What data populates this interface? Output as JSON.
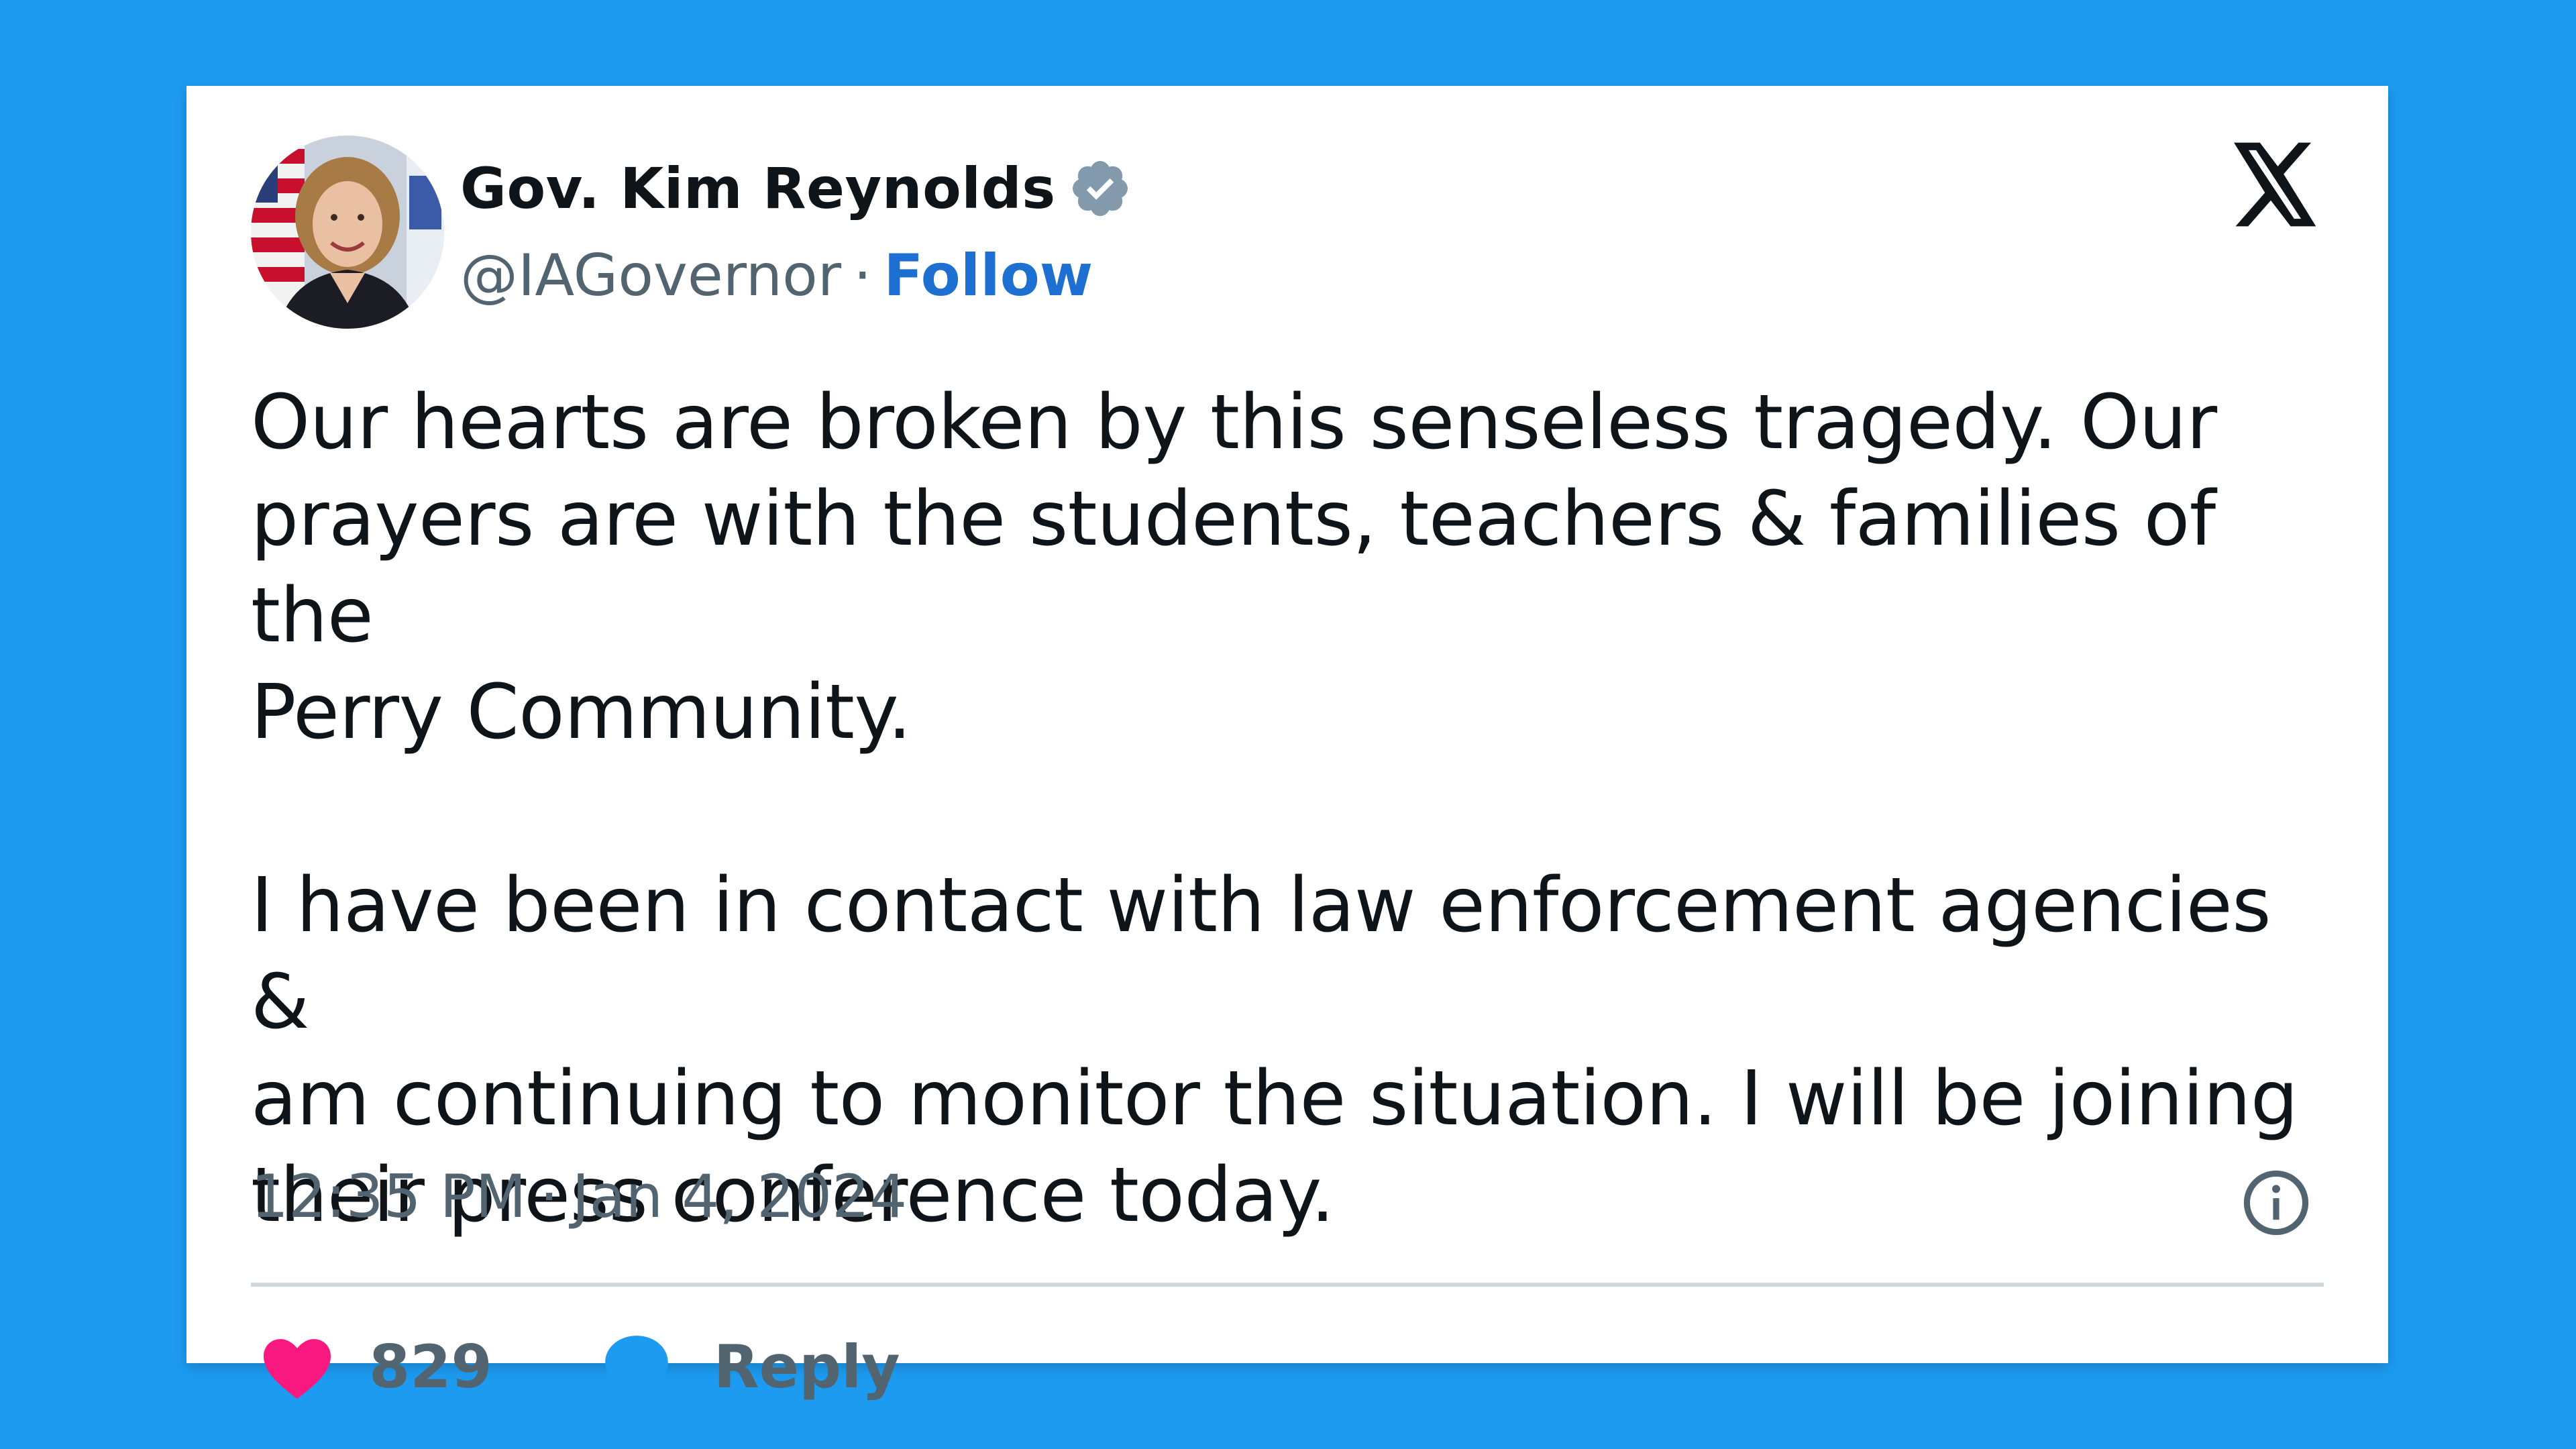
{
  "author": {
    "display_name": "Gov. Kim Reynolds",
    "handle": "@IAGovernor",
    "separator": "·",
    "follow_label": "Follow",
    "verified_icon": "verified-badge-icon",
    "avatar_icon": "avatar"
  },
  "tweet": {
    "paragraph_1": "Our hearts are broken by this senseless tragedy. Our\nprayers are with the students, teachers & families of the\nPerry Community.",
    "paragraph_2": "I have been in contact with law enforcement agencies &\nam continuing to monitor the situation. I will be joining\ntheir press conference today."
  },
  "meta": {
    "time": "12:35 PM",
    "separator": "·",
    "date": "Jan 4, 2024"
  },
  "actions": {
    "like_count": "829",
    "reply_label": "Reply"
  },
  "colors": {
    "background": "#1d9bf0",
    "card": "#ffffff",
    "follow": "#1d70d2",
    "like": "#f91880",
    "reply": "#1d9bf0",
    "muted": "#536471",
    "text": "#0f1419"
  }
}
